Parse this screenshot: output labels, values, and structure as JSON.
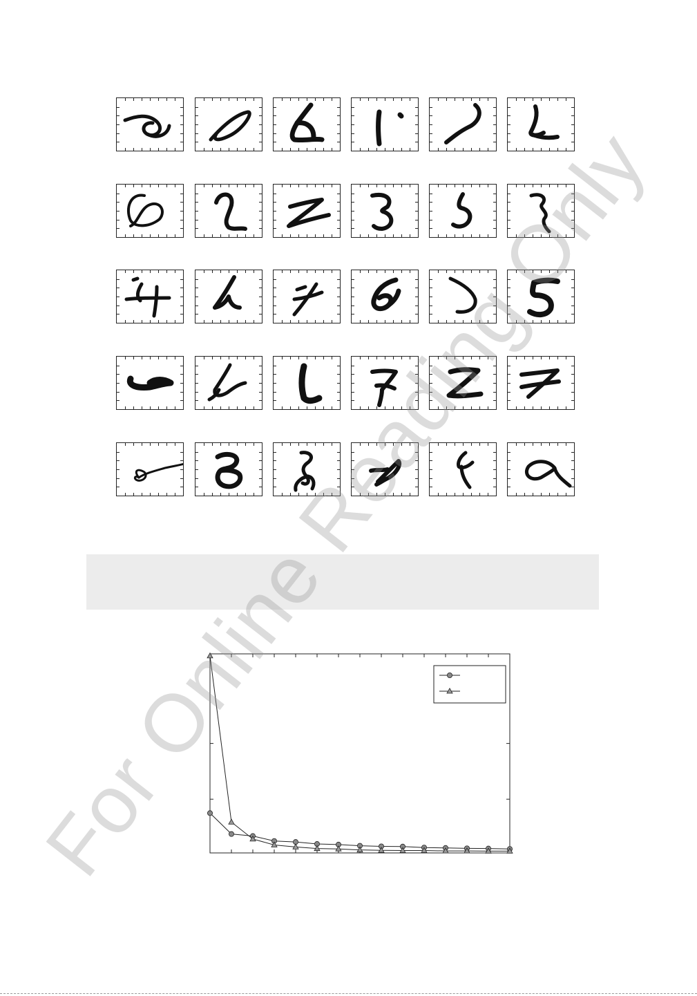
{
  "watermark": "For Online Reading Only",
  "digit_samples": {
    "rows": 5,
    "cols": 6,
    "count": 30
  },
  "chart_data": {
    "type": "line",
    "x": [
      1,
      2,
      3,
      4,
      5,
      6,
      7,
      8,
      9,
      10,
      11,
      12,
      13,
      14,
      15
    ],
    "ylim": [
      0,
      1
    ],
    "grid": false,
    "legend_position": "top-right",
    "series": [
      {
        "marker": "circle",
        "values": [
          0.2,
          0.095,
          0.085,
          0.06,
          0.055,
          0.045,
          0.042,
          0.036,
          0.033,
          0.032,
          0.027,
          0.025,
          0.023,
          0.022,
          0.02
        ]
      },
      {
        "marker": "triangle",
        "values": [
          0.99,
          0.155,
          0.07,
          0.04,
          0.03,
          0.022,
          0.02,
          0.015,
          0.013,
          0.012,
          0.012,
          0.01,
          0.01,
          0.009,
          0.009
        ]
      }
    ]
  }
}
